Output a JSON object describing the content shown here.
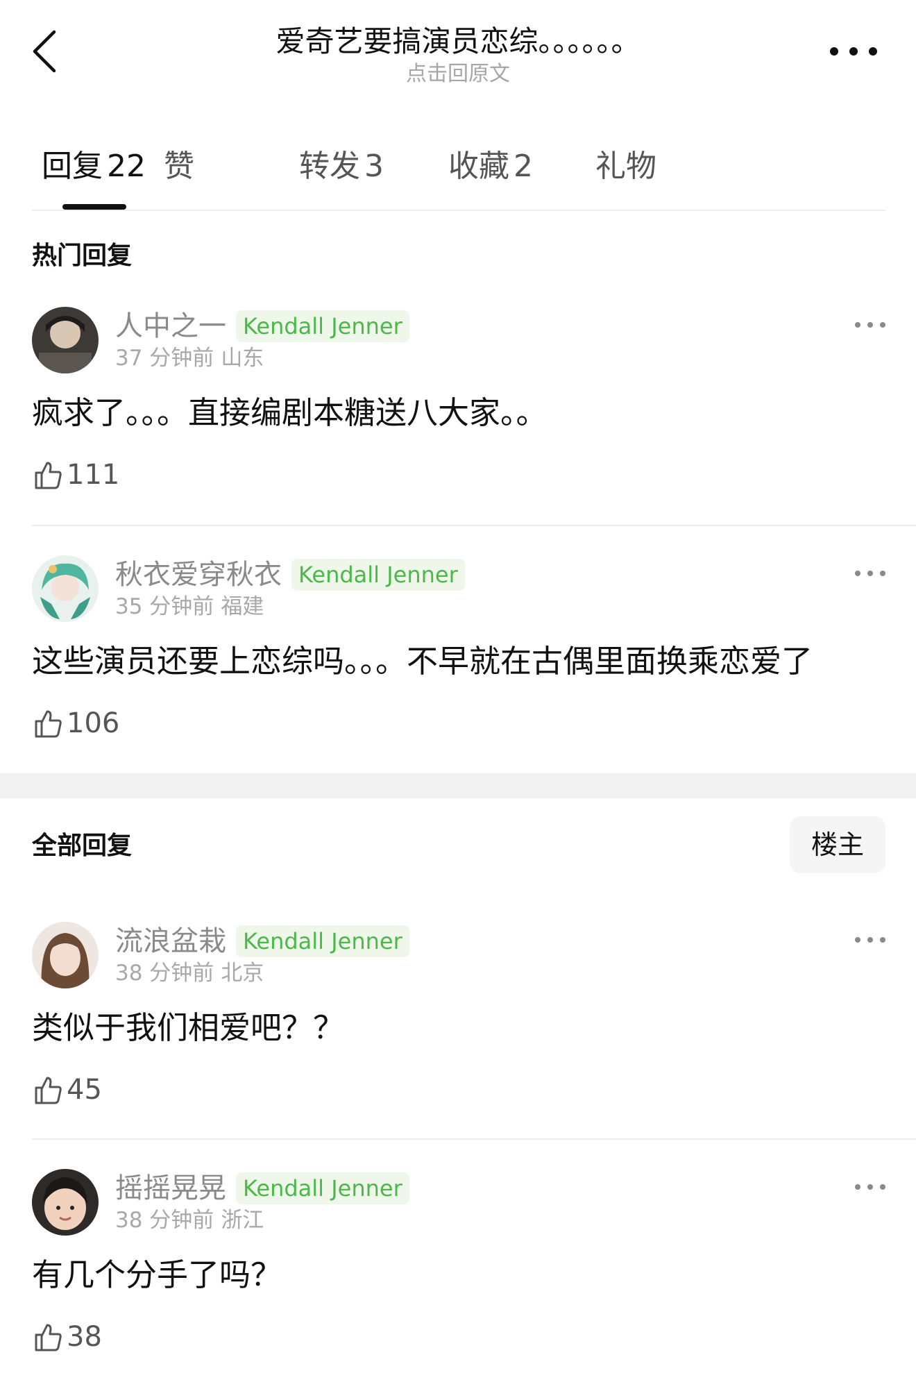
{
  "header": {
    "title": "爱奇艺要搞演员恋综。。。。。。",
    "subtitle": "点击回原文"
  },
  "tabs": [
    {
      "label": "回复",
      "count": "22",
      "active": true
    },
    {
      "label": "赞",
      "count": ""
    },
    {
      "label": "转发",
      "count": "3"
    },
    {
      "label": "收藏",
      "count": "2"
    },
    {
      "label": "礼物",
      "count": ""
    }
  ],
  "hot": {
    "title": "热门回复",
    "comments": [
      {
        "user": "人中之一",
        "badge": "Kendall Jenner",
        "time": "37 分钟前",
        "location": "山东",
        "text": "疯求了。。。直接编剧本糖送八大家。。",
        "likes": "111"
      },
      {
        "user": "秋衣爱穿秋衣",
        "badge": "Kendall Jenner",
        "time": "35 分钟前",
        "location": "福建",
        "text": "这些演员还要上恋综吗。。。不早就在古偶里面换乘恋爱了",
        "likes": "106"
      }
    ]
  },
  "all": {
    "title": "全部回复",
    "owner_filter": "楼主",
    "comments": [
      {
        "user": "流浪盆栽",
        "badge": "Kendall Jenner",
        "time": "38 分钟前",
        "location": "北京",
        "text": "类似于我们相爱吧？？",
        "likes": "45"
      },
      {
        "user": "摇摇晃晃",
        "badge": "Kendall Jenner",
        "time": "38 分钟前",
        "location": "浙江",
        "text": "有几个分手了吗？",
        "likes": "38"
      }
    ]
  },
  "colors": {
    "badge_text": "#4cb84a",
    "badge_bg": "#eef7ea",
    "muted": "#8a8a8a"
  }
}
